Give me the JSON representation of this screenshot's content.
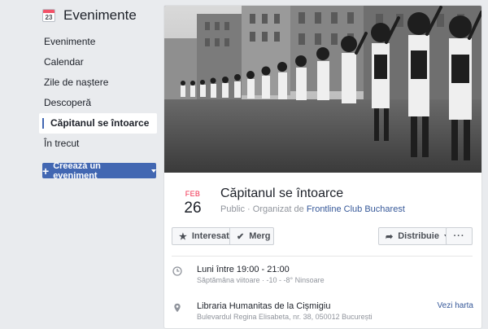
{
  "sidebar": {
    "icon_number": "23",
    "title": "Evenimente",
    "items": [
      {
        "label": "Evenimente"
      },
      {
        "label": "Calendar"
      },
      {
        "label": "Zile de naștere"
      },
      {
        "label": "Descoperă"
      },
      {
        "label": "Căpitanul se întoarce",
        "active": true
      },
      {
        "label": "În trecut"
      }
    ],
    "create_button": "Creează un eveniment"
  },
  "event": {
    "date_month": "FEB",
    "date_day": "26",
    "title": "Căpitanul se întoarce",
    "privacy": "Public",
    "organized_prefix": "Organizat de",
    "organizer": "Frontline Club Bucharest",
    "buttons": {
      "interested": "Interesat",
      "going": "Merg",
      "share": "Distribuie",
      "more": "···"
    },
    "time": {
      "main": "Luni între 19:00 - 21:00",
      "sub": "Săptămâna viitoare · -10 - -8° Ninsoare"
    },
    "location": {
      "main": "Libraria Humanitas de la Cișmigiu",
      "sub": "Bulevardul Regina Elisabeta, nr. 38, 050012 București",
      "map_link": "Vezi harta"
    }
  },
  "colors": {
    "accent": "#4267b2",
    "link": "#365899",
    "month_red": "#f02849"
  },
  "icons": [
    "calendar-icon",
    "star-icon",
    "check-icon",
    "share-icon",
    "clock-icon",
    "pin-icon"
  ]
}
